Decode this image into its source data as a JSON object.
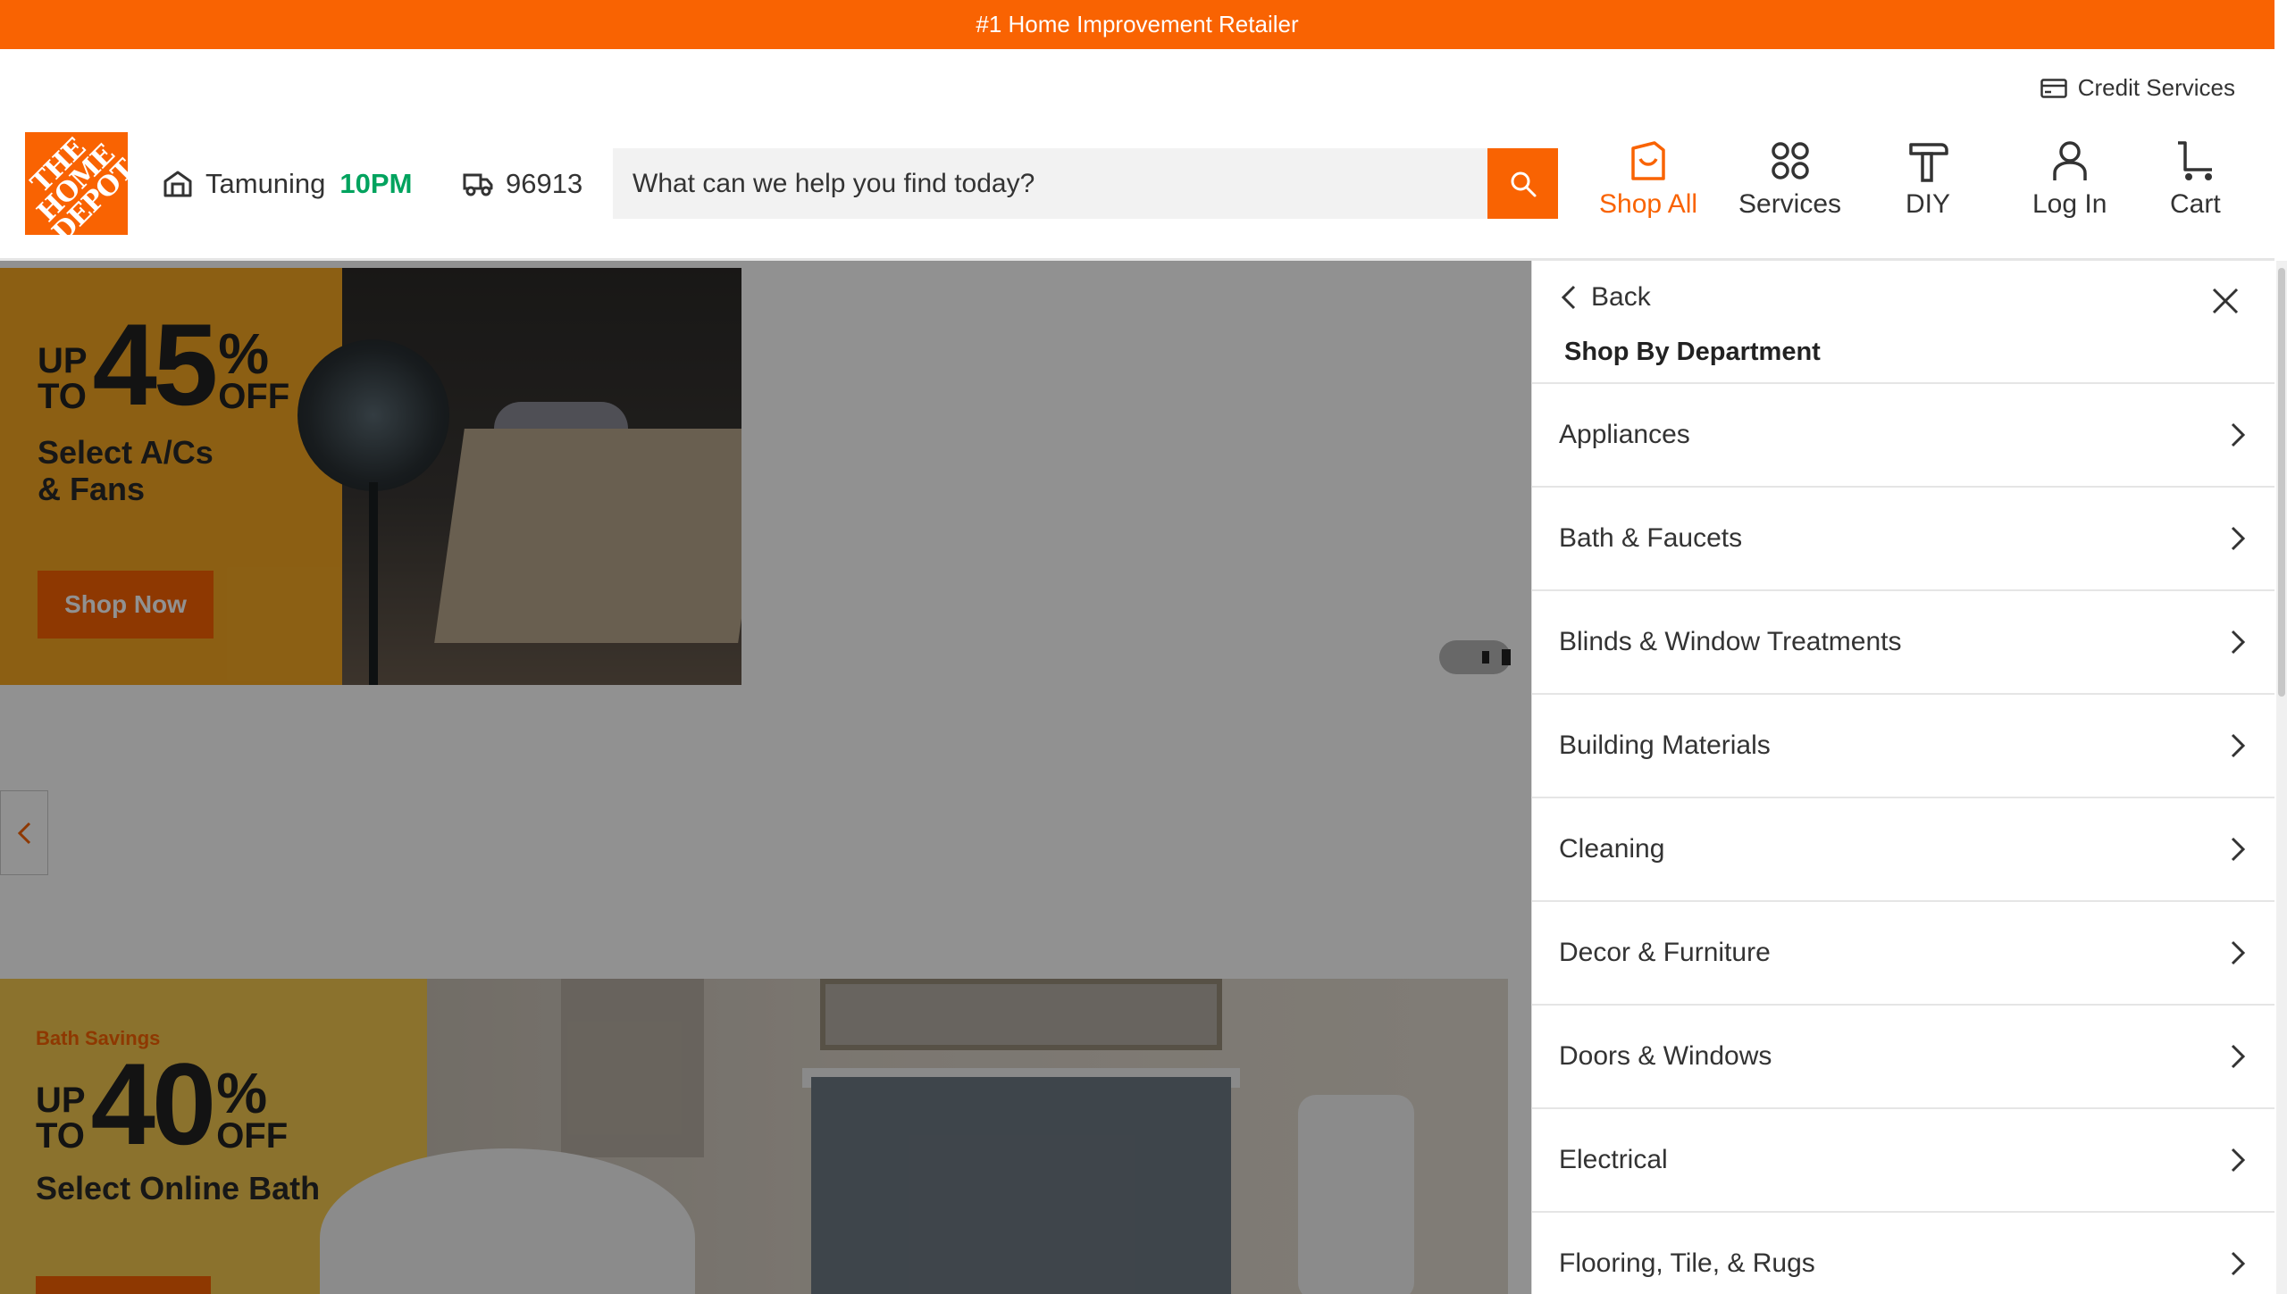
{
  "top_banner": {
    "text": "#1 Home Improvement Retailer"
  },
  "header": {
    "credit_services": "Credit Services",
    "logo_text": "THE HOME DEPOT",
    "store": {
      "name": "Tamuning",
      "hours": "10PM"
    },
    "delivery_zip": "96913",
    "search": {
      "placeholder": "What can we help you find today?"
    },
    "nav": [
      {
        "label": "Shop All",
        "icon": "shop-all-icon",
        "active": true
      },
      {
        "label": "Services",
        "icon": "services-icon",
        "active": false
      },
      {
        "label": "DIY",
        "icon": "diy-hammer-icon",
        "active": false
      },
      {
        "label": "Log In",
        "icon": "user-icon",
        "active": false
      },
      {
        "label": "Cart",
        "icon": "cart-icon",
        "active": false
      }
    ]
  },
  "hero": {
    "banner1": {
      "up_to": [
        "UP",
        "TO"
      ],
      "percent": "45",
      "pct_symbol": "%",
      "off": "OFF",
      "subtitle_line1": "Select A/Cs",
      "subtitle_line2": "& Fans",
      "cta": "Shop Now"
    },
    "banner2": {
      "eyebrow": "Bath Savings",
      "up_to": [
        "UP",
        "TO"
      ],
      "percent": "40",
      "pct_symbol": "%",
      "off": "OFF",
      "subtitle": "Select Online Bath"
    }
  },
  "panel": {
    "back_label": "Back",
    "title": "Shop By Department",
    "departments": [
      "Appliances",
      "Bath & Faucets",
      "Blinds & Window Treatments",
      "Building Materials",
      "Cleaning",
      "Decor & Furniture",
      "Doors & Windows",
      "Electrical",
      "Flooring, Tile, & Rugs"
    ]
  },
  "colors": {
    "brand_orange": "#f96302",
    "hours_green": "#00a35e",
    "banner1_bg": "#f7a823",
    "banner2_bg": "#f5c94f"
  }
}
